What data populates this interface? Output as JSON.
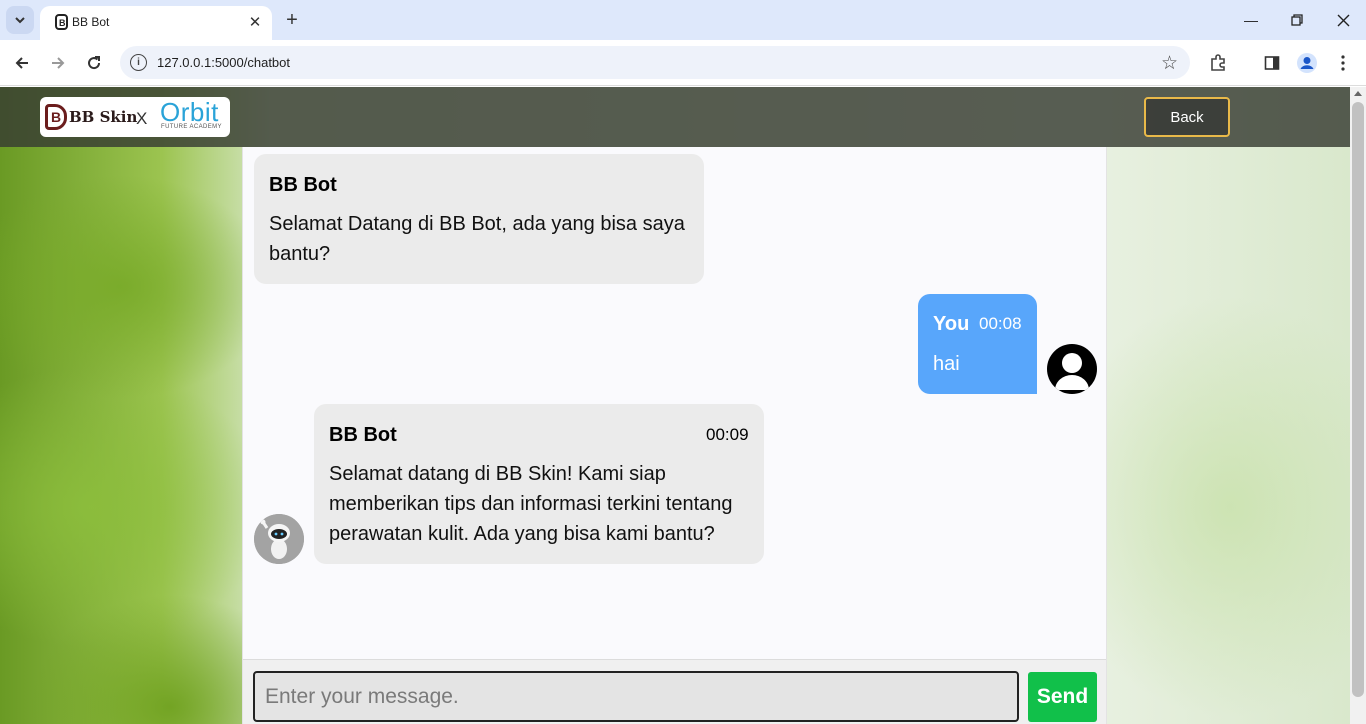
{
  "browser": {
    "tab_title": "BB Bot",
    "url": "127.0.0.1:5000/chatbot",
    "icons": [
      "chevron-down-icon",
      "close-icon",
      "plus-icon",
      "minimize-icon",
      "restore-icon",
      "close-window-icon",
      "back-arrow-icon",
      "forward-arrow-icon",
      "reload-icon",
      "info-icon",
      "star-icon",
      "extensions-icon",
      "sidebar-icon",
      "profile-icon",
      "kebab-menu-icon"
    ]
  },
  "header": {
    "logo_left": "BB Skin",
    "logo_x": "X",
    "logo_right": "Orbit",
    "logo_right_sub": "FUTURE ACADEMY",
    "back_label": "Back"
  },
  "messages": [
    {
      "sender": "BB Bot",
      "time": "",
      "text": "Selamat Datang di BB Bot, ada yang bisa saya bantu?"
    },
    {
      "sender": "You",
      "time": "00:08",
      "text": "hai"
    },
    {
      "sender": "BB Bot",
      "time": "00:09",
      "text": "Selamat datang di BB Skin! Kami siap memberikan tips dan informasi terkini tentang perawatan kulit. Ada yang bisa kami bantu?"
    }
  ],
  "input": {
    "placeholder": "Enter your message.",
    "value": "",
    "send_label": "Send"
  },
  "colors": {
    "user_bubble": "#58a6fb",
    "bot_bubble": "#ebebeb",
    "send_button": "#11c04a",
    "back_border": "#e9b949"
  }
}
